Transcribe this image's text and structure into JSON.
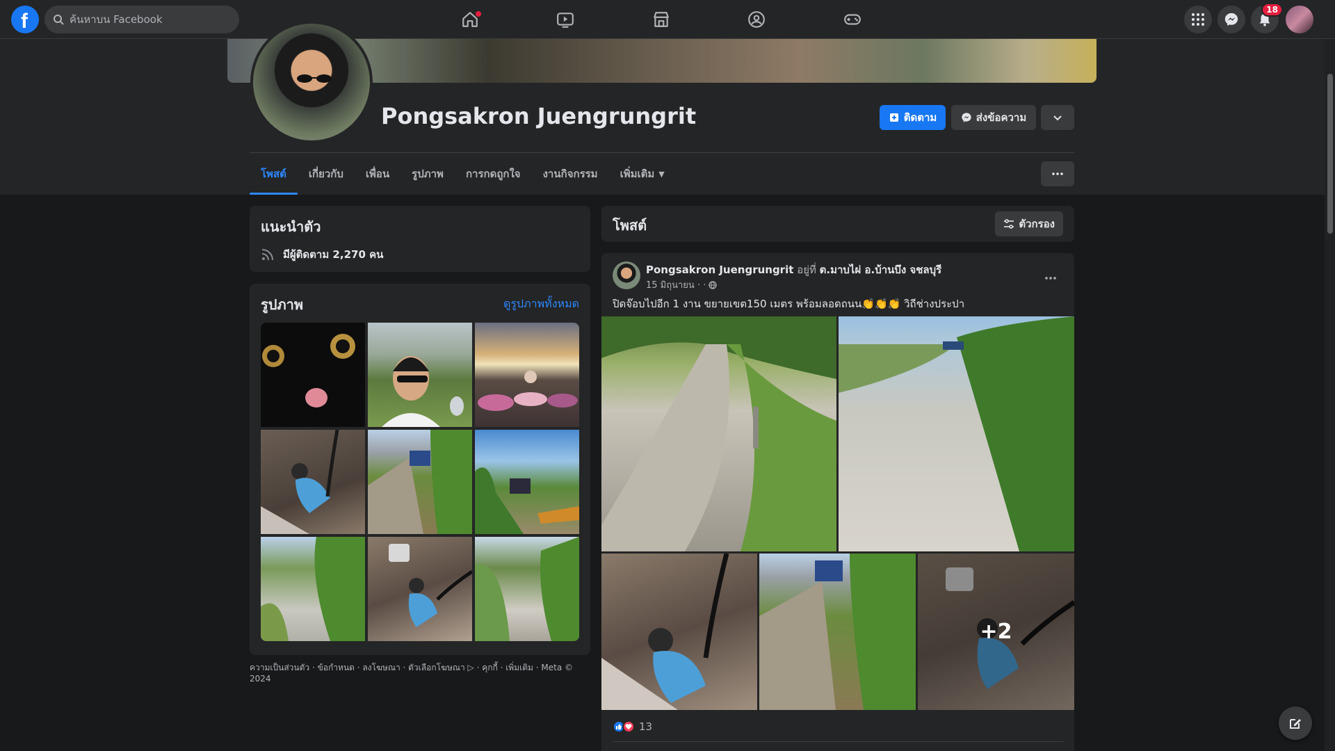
{
  "search": {
    "placeholder": "ค้นหาบน Facebook"
  },
  "topbar": {
    "notifications_count": "18",
    "home_has_dot": true
  },
  "profile": {
    "name": "Pongsakron Juengrungrit",
    "follow_label": "ติดตาม",
    "message_label": "ส่งข้อความ"
  },
  "tabs": [
    {
      "label": "โพสต์",
      "active": true
    },
    {
      "label": "เกี่ยวกับ"
    },
    {
      "label": "เพื่อน"
    },
    {
      "label": "รูปภาพ"
    },
    {
      "label": "การกดถูกใจ"
    },
    {
      "label": "งานกิจกรรม"
    },
    {
      "label": "เพิ่มเติม"
    }
  ],
  "intro": {
    "title": "แนะนำตัว",
    "followers_text": "มีผู้ติดตาม 2,270 คน"
  },
  "photos": {
    "title": "รูปภาพ",
    "see_all": "ดูรูปภาพทั้งหมด"
  },
  "footer": {
    "text": "ความเป็นส่วนตัว · ข้อกำหนด · ลงโฆษณา · ตัวเลือกโฆษณา ▷ · คุกกี้ · เพิ่มเติม · Meta © 2024"
  },
  "posts_header": {
    "title": "โพสต์",
    "filter_label": "ตัวกรอง"
  },
  "post": {
    "author": "Pongsakron Juengrungrit",
    "at_word": "อยู่ที่",
    "location": "ต.มาบไผ่ อ.บ้านบึง จชลบุรี",
    "date": "15 มิถุนายน · ·",
    "text": "ปิดจ๊อบไปอีก 1 งาน ขยายเขต150 เมตร พร้อมลอดถนน👏👏👏 วิถีช่างประปา",
    "more_photos": "+2",
    "reaction_count": "13"
  },
  "colors": {
    "accent": "#1877f2",
    "link": "#2d88ff",
    "background": "#18191a",
    "card": "#242526",
    "badge": "#e41e3f"
  }
}
